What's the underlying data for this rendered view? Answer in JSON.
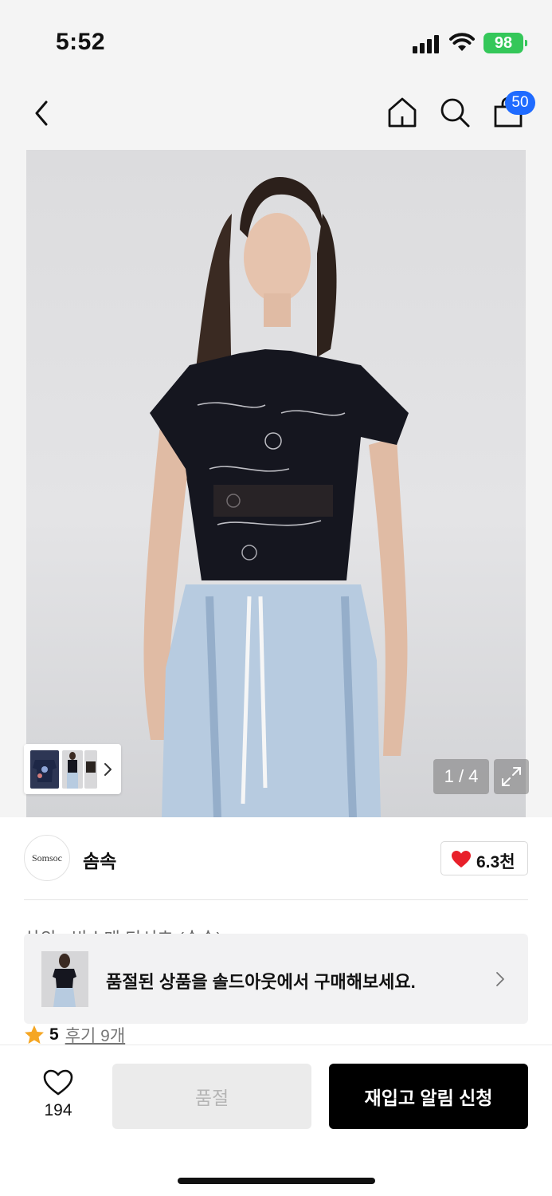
{
  "status_bar": {
    "time": "5:52",
    "battery": "98"
  },
  "nav": {
    "back_icon": "chevron-left-icon",
    "home_icon": "home-icon",
    "search_icon": "search-icon",
    "cart_icon": "shopping-bag-icon",
    "cart_count": "50",
    "badge_color": "#1f6bff"
  },
  "gallery": {
    "counter": "1 / 4",
    "expand_icon": "expand-icon",
    "thumbnail_count": 3
  },
  "brand": {
    "logo_text": "Somsoc",
    "name": "솜속",
    "likes": "6.3천",
    "heart_color": "#e8202a"
  },
  "product": {
    "title_partial": "상의 · 반소매 티셔츠 (솜속)"
  },
  "soldout_banner": {
    "message": "품절된 상품을 솔드아웃에서 구매해보세요."
  },
  "rating": {
    "score": "5",
    "reviews": "후기 9개",
    "star_color": "#f5a623"
  },
  "bottom_bar": {
    "wishlist_count": "194",
    "soldout_label": "품절",
    "restock_label": "재입고 알림 신청"
  }
}
